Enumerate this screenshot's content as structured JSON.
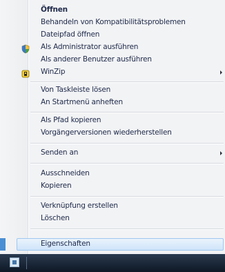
{
  "menu": {
    "items": [
      {
        "label": "Öffnen",
        "bold": true
      },
      {
        "label": "Behandeln von Kompatibilitätsproblemen"
      },
      {
        "label": "Dateipfad öffnen"
      },
      {
        "label": "Als Administrator ausführen",
        "icon": "uac-shield-icon"
      },
      {
        "label": "Als anderer Benutzer ausführen"
      },
      {
        "label": "WinZip",
        "icon": "winzip-icon",
        "submenu": true
      },
      {
        "label": "Von Taskleiste lösen"
      },
      {
        "label": "An Startmenü anheften"
      },
      {
        "label": "Als Pfad kopieren"
      },
      {
        "label": "Vorgängerversionen wiederherstellen"
      },
      {
        "label": "Senden an",
        "submenu": true
      },
      {
        "label": "Ausschneiden"
      },
      {
        "label": "Kopieren"
      },
      {
        "label": "Verknüpfung erstellen"
      },
      {
        "label": "Löschen"
      },
      {
        "label": "Eigenschaften",
        "highlighted": true
      }
    ]
  },
  "colors": {
    "highlight": "#cfe4f9",
    "taskbar": "#0e1825"
  }
}
